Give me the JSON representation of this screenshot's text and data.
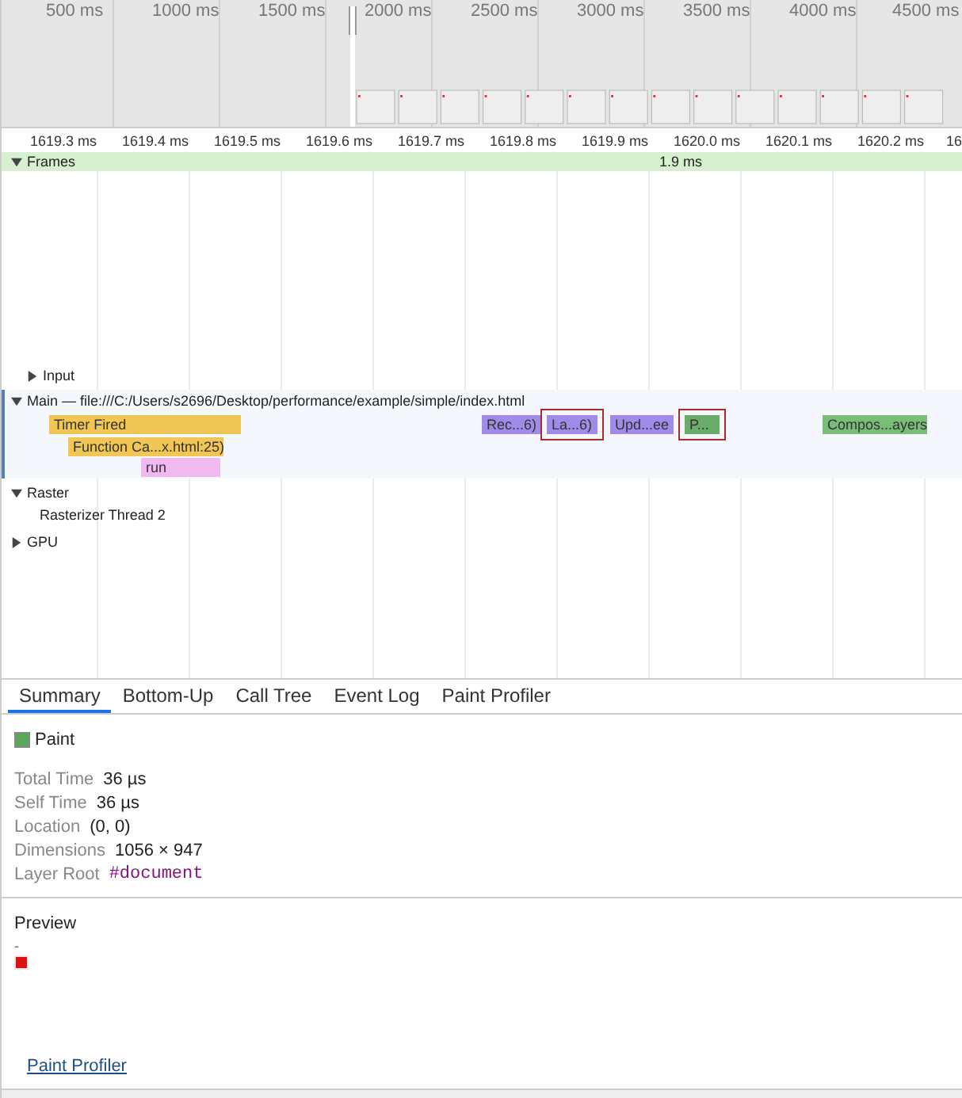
{
  "overview": {
    "ticks": [
      "500 ms",
      "1000 ms",
      "1500 ms",
      "2000 ms",
      "2500 ms",
      "3000 ms",
      "3500 ms",
      "4000 ms",
      "4500 ms"
    ]
  },
  "ruler": {
    "ticks": [
      "1619.3 ms",
      "1619.4 ms",
      "1619.5 ms",
      "1619.6 ms",
      "1619.7 ms",
      "1619.8 ms",
      "1619.9 ms",
      "1620.0 ms",
      "1620.1 ms",
      "1620.2 ms",
      "16"
    ]
  },
  "frames": {
    "label": "Frames",
    "expanded": true,
    "duration": "1.9 ms"
  },
  "input": {
    "label": "Input",
    "expanded": false
  },
  "main": {
    "label": "Main — file:///C:/Users/s2696/Desktop/performance/example/simple/index.html",
    "expanded": true,
    "events": [
      {
        "label": "Timer Fired",
        "color": "#f0c655",
        "outlined": false,
        "children": [
          {
            "label": "Function Ca...x.html:25)",
            "color": "#f0c655",
            "outlined": false,
            "children": [
              {
                "label": "run",
                "color": "#f2b8f0",
                "outlined": false
              }
            ]
          }
        ]
      },
      {
        "label": "Rec...6)",
        "color": "#a08ce8",
        "outlined": false
      },
      {
        "label": "La...6)",
        "color": "#a08ce8",
        "outlined": true
      },
      {
        "label": "Upd...ee",
        "color": "#a08ce8",
        "outlined": false
      },
      {
        "label": "P...",
        "color": "#6aad6a",
        "outlined": true
      },
      {
        "label": "Compos...ayers",
        "color": "#79bd79",
        "outlined": false
      }
    ]
  },
  "raster": {
    "label": "Raster",
    "expanded": true,
    "children": [
      {
        "label": "Rasterizer Thread 2"
      }
    ]
  },
  "gpu": {
    "label": "GPU",
    "expanded": false
  },
  "tabs": [
    {
      "label": "Summary",
      "selected": true
    },
    {
      "label": "Bottom-Up",
      "selected": false
    },
    {
      "label": "Call Tree",
      "selected": false
    },
    {
      "label": "Event Log",
      "selected": false
    },
    {
      "label": "Paint Profiler",
      "selected": false
    }
  ],
  "summary": {
    "title": "Paint",
    "color": "#5aa85a",
    "rows": [
      {
        "label": "Total Time",
        "value": "36 µs",
        "kind": "text"
      },
      {
        "label": "Self Time",
        "value": "36 µs",
        "kind": "text"
      },
      {
        "label": "Location",
        "value": "(0, 0)",
        "kind": "text"
      },
      {
        "label": "Dimensions",
        "value": "1056 × 947",
        "kind": "text"
      },
      {
        "label": "Layer Root",
        "value": "#document",
        "kind": "node"
      }
    ]
  },
  "preview": {
    "title": "Preview",
    "caption": "-"
  },
  "link": "Paint Profiler"
}
